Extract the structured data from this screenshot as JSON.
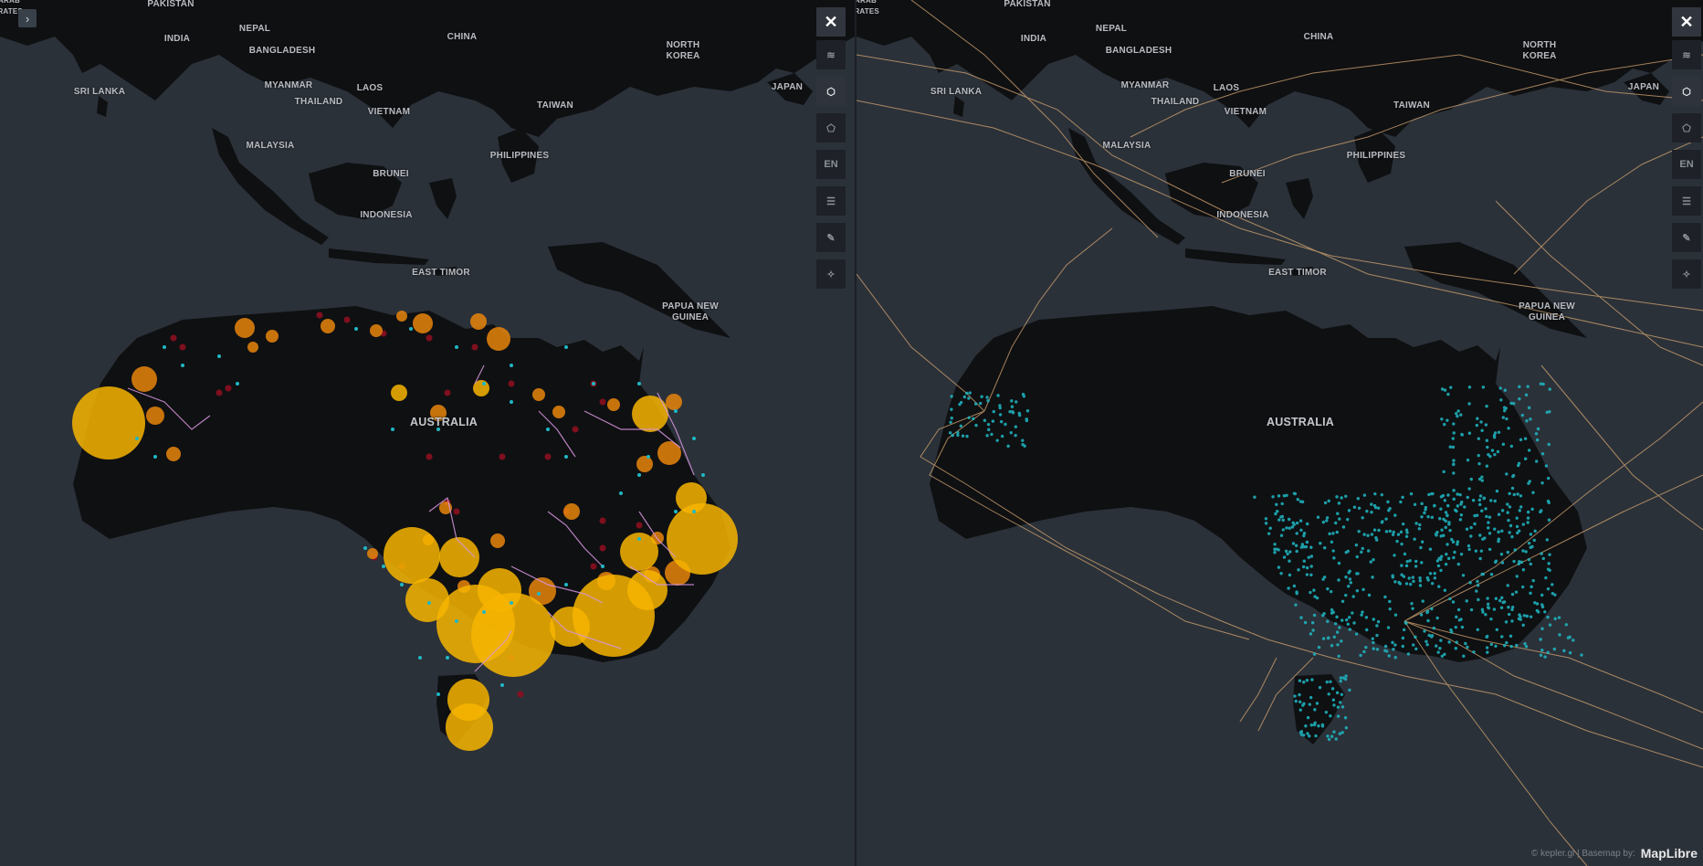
{
  "left_map": {
    "country_labels": [
      {
        "name": "PAKISTAN"
      },
      {
        "name": "NEPAL"
      },
      {
        "name": "CHINA"
      },
      {
        "name": "INDIA"
      },
      {
        "name": "BANGLADESH"
      },
      {
        "name": "NORTH\nKOREA"
      },
      {
        "name": "MYANMAR"
      },
      {
        "name": "LAOS"
      },
      {
        "name": "JAPAN"
      },
      {
        "name": "SRI LANKA"
      },
      {
        "name": "THAILAND"
      },
      {
        "name": "VIETNAM"
      },
      {
        "name": "TAIWAN"
      },
      {
        "name": "MALAYSIA"
      },
      {
        "name": "PHILIPPINES"
      },
      {
        "name": "BRUNEI"
      },
      {
        "name": "INDONESIA"
      },
      {
        "name": "EAST TIMOR"
      },
      {
        "name": "PAPUA NEW\nGUINEA"
      },
      {
        "name": "AUSTRALIA"
      }
    ],
    "partial_label": "ARAB\nIRATES"
  },
  "right_map": {
    "country_labels": [
      {
        "name": "PAKISTAN"
      },
      {
        "name": "NEPAL"
      },
      {
        "name": "CHINA"
      },
      {
        "name": "INDIA"
      },
      {
        "name": "BANGLADESH"
      },
      {
        "name": "NORTH\nKOREA"
      },
      {
        "name": "MYANMAR"
      },
      {
        "name": "LAOS"
      },
      {
        "name": "JAPAN"
      },
      {
        "name": "SRI LANKA"
      },
      {
        "name": "THAILAND"
      },
      {
        "name": "VIETNAM"
      },
      {
        "name": "TAIWAN"
      },
      {
        "name": "MALAYSIA"
      },
      {
        "name": "PHILIPPINES"
      },
      {
        "name": "BRUNEI"
      },
      {
        "name": "INDONESIA"
      },
      {
        "name": "EAST TIMOR"
      },
      {
        "name": "PAPUA NEW\nGUINEA"
      },
      {
        "name": "AUSTRALIA"
      }
    ],
    "partial_label": "ARAB\nIRATES"
  },
  "toolbar": {
    "buttons": [
      {
        "icon": "close-icon",
        "glyph": "✕"
      },
      {
        "icon": "layers-icon",
        "glyph": "≋"
      },
      {
        "icon": "cube-3d-icon",
        "glyph": "⬡"
      },
      {
        "icon": "draw-polygon-icon",
        "glyph": "⬠"
      },
      {
        "icon": "language-icon",
        "glyph": "EN"
      },
      {
        "icon": "legend-icon",
        "glyph": "☰"
      },
      {
        "icon": "ruler-icon",
        "glyph": "✎"
      },
      {
        "icon": "ai-assistant-icon",
        "glyph": "✧"
      }
    ]
  },
  "sidebar_toggle": {
    "glyph": "›"
  },
  "attribution": {
    "text": "© kepler.gl | Basemap by:",
    "logo": "MapLibre"
  },
  "colors": {
    "water": "#2b3139",
    "land": "#0f1012",
    "bubble_yellow": "#f7b500",
    "bubble_orange": "#e8850c",
    "bubble_red": "#8c1020",
    "cyan_point": "#1fb8c4",
    "cable_line": "#d6a772",
    "pink_line": "#d896e0"
  }
}
